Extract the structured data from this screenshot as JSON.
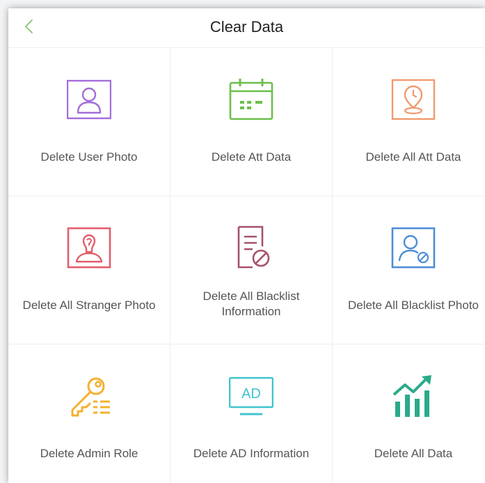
{
  "header": {
    "title": "Clear Data",
    "back_icon": "chevron-left-icon"
  },
  "colors": {
    "purple": "#a46ed9",
    "green": "#6cbf4a",
    "orange": "#f09a6e",
    "red": "#e45c6c",
    "maroon": "#a6526a",
    "blue": "#4d8ed6",
    "yellow": "#f4b12f",
    "cyan": "#3fc4cf",
    "teal": "#2aaa8a",
    "back": "#7ec36a"
  },
  "tiles": [
    {
      "label": "Delete User Photo",
      "icon": "user-photo-icon"
    },
    {
      "label": "Delete Att Data",
      "icon": "calendar-icon"
    },
    {
      "label": "Delete All Att Data",
      "icon": "clock-pin-icon"
    },
    {
      "label": "Delete All Stranger Photo",
      "icon": "stranger-photo-icon"
    },
    {
      "label": "Delete All Blacklist Information",
      "icon": "blacklist-document-icon"
    },
    {
      "label": "Delete All Blacklist Photo",
      "icon": "blacklist-photo-icon"
    },
    {
      "label": "Delete Admin Role",
      "icon": "admin-key-icon"
    },
    {
      "label": "Delete AD Information",
      "icon": "ad-monitor-icon"
    },
    {
      "label": "Delete All Data",
      "icon": "chart-icon"
    }
  ],
  "ad_text": "AD"
}
